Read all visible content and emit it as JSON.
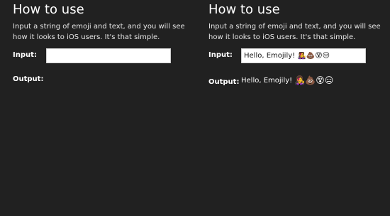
{
  "left_panel": {
    "title": "How to use",
    "description": "Input a string of emoji and text, and you will see how it looks to iOS users. It's that simple.",
    "input_label": "Input:",
    "input_value": "",
    "output_label": "Output:",
    "output_value": ""
  },
  "right_panel": {
    "title": "How to use",
    "description": "Input a string of emoji and text, and you will see how it looks to iOS users. It's that simple.",
    "input_label": "Input:",
    "input_value": "Hello, Emojily! 👩‍🎤💩😵😑",
    "output_label": "Output:",
    "output_text": "Hello, Emojily!",
    "output_emoji": [
      "👩‍🎤",
      "💩",
      "😵",
      "😑"
    ]
  }
}
